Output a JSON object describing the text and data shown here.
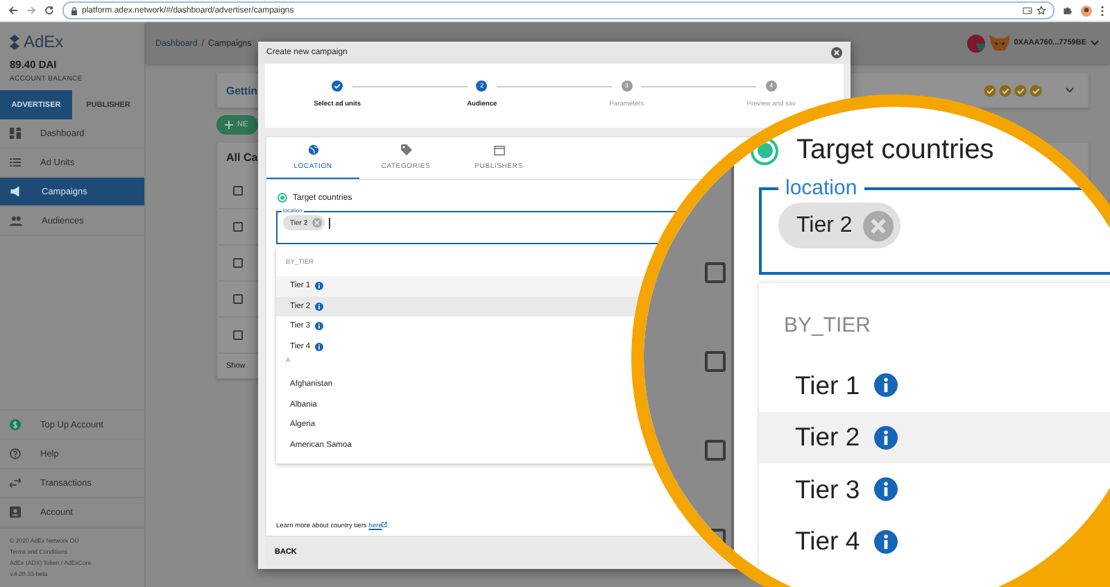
{
  "browser": {
    "url": "platform.adex.network/#/dashboard/advertiser/campaigns"
  },
  "sidebar": {
    "logo": "AdEx",
    "balance": "89.40 DAI",
    "balance_label": "ACCOUNT BALANCE",
    "roles": [
      {
        "label": "ADVERTISER",
        "selected": true
      },
      {
        "label": "PUBLISHER",
        "selected": false
      }
    ],
    "nav": [
      {
        "label": "Dashboard",
        "selected": false
      },
      {
        "label": "Ad Units",
        "selected": false
      },
      {
        "label": "Campaigns",
        "selected": true
      },
      {
        "label": "Audiences",
        "selected": false
      }
    ],
    "bottom_nav": [
      {
        "label": "Top Up Account"
      },
      {
        "label": "Help"
      },
      {
        "label": "Transactions"
      },
      {
        "label": "Account"
      }
    ],
    "footer": [
      "© 2020  AdEx Network OÜ",
      "Terms and Conditions",
      "AdEx (ADX) Token / AdExCore",
      "v.4.20.33-beta"
    ]
  },
  "header": {
    "breadcrumb": [
      "Dashboard",
      "Campaigns"
    ],
    "separator": "/",
    "wallet": "0XAAA760...7759BE"
  },
  "page": {
    "card_title": "Gettin",
    "new_button": "NE",
    "list_title": "All Ca",
    "show": "Show",
    "rows": [
      {
        "checked": false
      },
      {
        "checked": false
      },
      {
        "checked": false
      },
      {
        "checked": false
      },
      {
        "checked": false
      }
    ]
  },
  "modal": {
    "title": "Create new campaign",
    "steps": [
      {
        "label": "Select ad units",
        "completed": true,
        "current": false
      },
      {
        "label": "Audience",
        "number": "2",
        "completed": false,
        "current": true
      },
      {
        "label": "Parameters",
        "number": "3",
        "completed": false,
        "current": false
      },
      {
        "label": "Preview and sav",
        "number": "4",
        "completed": false,
        "current": false
      }
    ],
    "tabs": [
      {
        "label": "LOCATION",
        "selected": true
      },
      {
        "label": "CATEGORIES",
        "selected": false
      },
      {
        "label": "PUBLISHERS",
        "selected": false
      }
    ],
    "target": {
      "label": "Target countries",
      "selected": true
    },
    "field": {
      "legend": "location",
      "chips": [
        "Tier 2"
      ]
    },
    "groups": [
      {
        "heading": "BY_TIER",
        "items": [
          {
            "label": "Tier 1",
            "info": true,
            "selected": false,
            "hovered": true
          },
          {
            "label": "Tier 2",
            "info": true,
            "selected": true,
            "hovered": false
          },
          {
            "label": "Tier 3",
            "info": true,
            "selected": false,
            "hovered": false
          },
          {
            "label": "Tier 4",
            "info": true,
            "selected": false,
            "hovered": false
          }
        ]
      },
      {
        "heading": "A",
        "items": [
          {
            "label": "Afghanistan",
            "info": false,
            "selected": false,
            "hovered": false
          },
          {
            "label": "Albania",
            "info": false,
            "selected": false,
            "hovered": false
          },
          {
            "label": "Algeria",
            "info": false,
            "selected": false,
            "hovered": false
          },
          {
            "label": "American Samoa",
            "info": false,
            "selected": false,
            "hovered": false
          }
        ]
      }
    ],
    "note": {
      "text": "Learn more about country tiers",
      "link": "here"
    },
    "back": "BACK"
  },
  "magnifier": {
    "target": {
      "label": "Target countries",
      "selected": true
    },
    "legend": "location",
    "chip": "Tier 2",
    "heading": "BY_TIER",
    "items": [
      {
        "label": "Tier 1",
        "selected": false
      },
      {
        "label": "Tier 2",
        "selected": true
      },
      {
        "label": "Tier 3",
        "selected": false
      },
      {
        "label": "Tier 4",
        "selected": false
      }
    ]
  }
}
